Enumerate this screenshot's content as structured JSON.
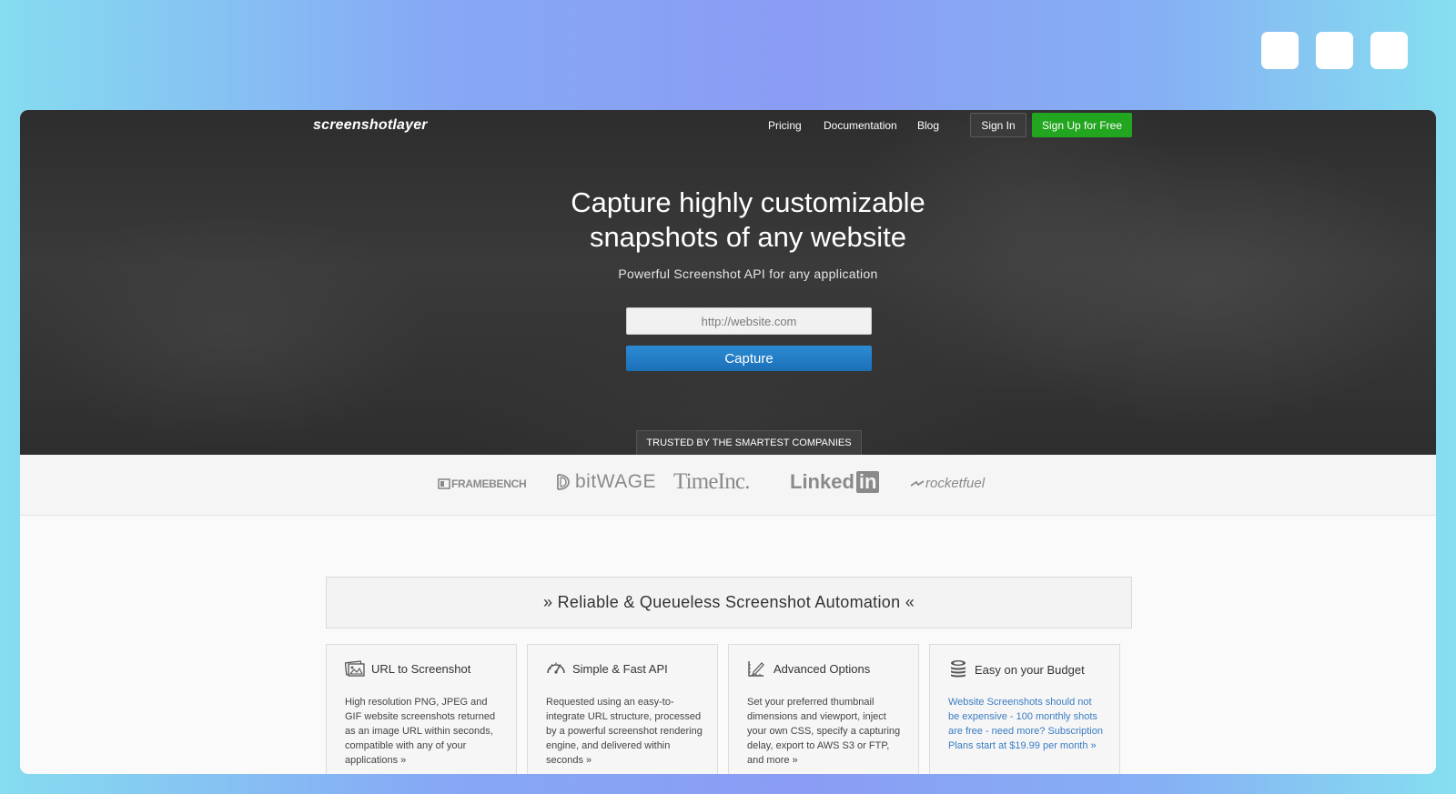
{
  "window": {
    "controls": [
      "window-button",
      "window-button",
      "window-button"
    ]
  },
  "header": {
    "logo": "screenshotlayer",
    "nav": {
      "pricing": "Pricing",
      "documentation": "Documentation",
      "blog": "Blog",
      "sign_in": "Sign In",
      "sign_up": "Sign Up for Free"
    }
  },
  "hero": {
    "title_line1": "Capture highly customizable",
    "title_line2": "snapshots of any website",
    "subtitle": "Powerful Screenshot API for any application",
    "url_placeholder": "http://website.com",
    "capture_label": "Capture",
    "trusted_label": "TRUSTED BY THE SMARTEST COMPANIES"
  },
  "brands": {
    "framebench": "FRAMEBENCH",
    "bitwage": "bitWAGE",
    "timeinc": "TimeInc.",
    "linkedin_text": "Linked",
    "linkedin_box": "in",
    "rocketfuel": "rocketfuel"
  },
  "features": {
    "heading": "» Reliable & Queueless Screenshot Automation «",
    "cards": [
      {
        "title": "URL to Screenshot",
        "icon": "screenshot-icon",
        "text": "High resolution PNG, JPEG and GIF website screenshots returned as an image URL within seconds, compatible with any of your applications »"
      },
      {
        "title": "Simple & Fast API",
        "icon": "speedometer-icon",
        "text": "Requested using an easy-to-integrate URL structure, processed by a powerful screenshot rendering engine, and delivered within seconds »"
      },
      {
        "title": "Advanced Options",
        "icon": "ruler-pencil-icon",
        "text": "Set your preferred thumbnail dimensions and viewport, inject your own CSS, specify a capturing delay, export to AWS S3 or FTP, and more »"
      },
      {
        "title": "Easy on your Budget",
        "icon": "coins-icon",
        "text": "Website Screenshots should not be expensive - 100 monthly shots are free - need more? Subscription Plans start at $19.99 per month »"
      }
    ]
  },
  "colors": {
    "accent_blue": "#1f78c1",
    "signup_green": "#22a51f",
    "link_blue": "#3a7cc3"
  }
}
